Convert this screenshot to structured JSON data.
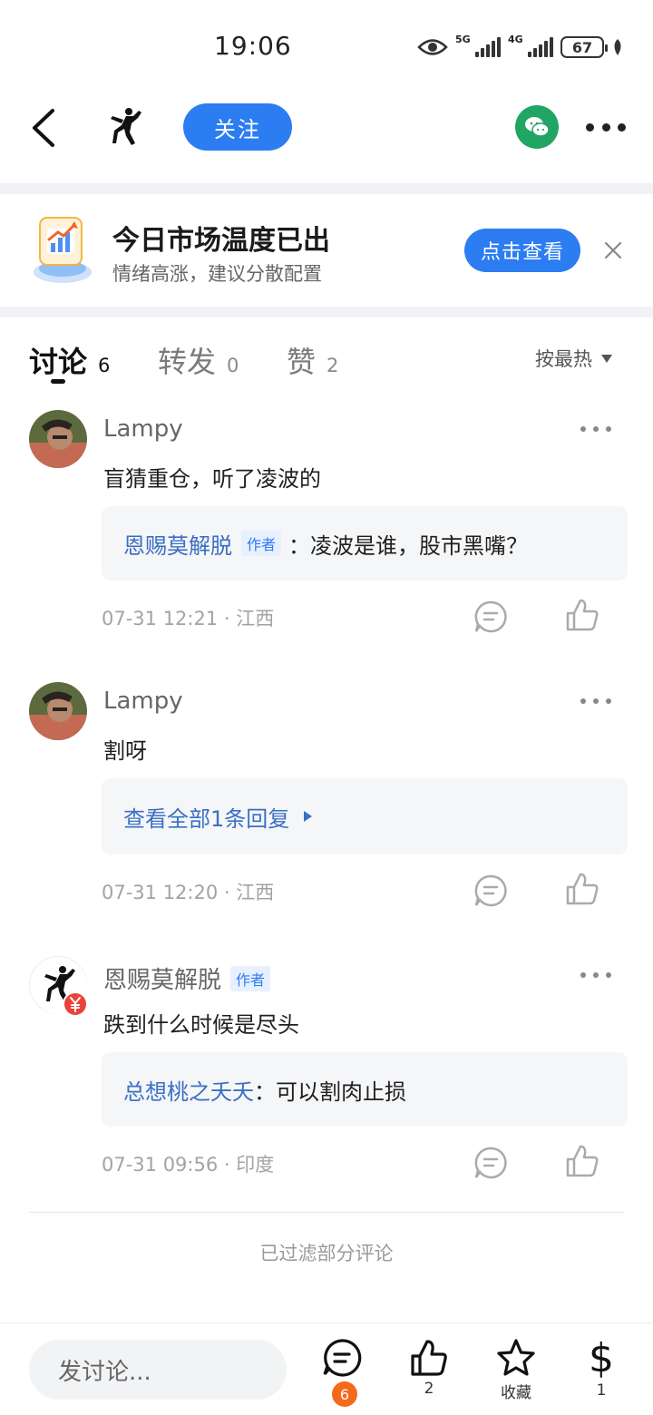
{
  "status_bar": {
    "time": "19:06",
    "net1": "5G",
    "net2": "4G",
    "battery": "67"
  },
  "nav": {
    "follow_label": "关注"
  },
  "banner": {
    "title": "今日市场温度已出",
    "subtitle": "情绪高涨，建议分散配置",
    "button": "点击查看"
  },
  "tabs": [
    {
      "label": "讨论",
      "count": "6"
    },
    {
      "label": "转发",
      "count": "0"
    },
    {
      "label": "赞",
      "count": "2"
    }
  ],
  "sort_label": "按最热",
  "comments": [
    {
      "author": "Lampy",
      "text": "盲猜重仓，听了凌波的",
      "reply_name": "恩赐莫解脱",
      "reply_tag": "作者",
      "reply_text": "：凌波是谁，股市黑嘴？",
      "time": "07-31 12:21 · 江西"
    },
    {
      "author": "Lampy",
      "text": "割呀",
      "view_replies": "查看全部1条回复",
      "time": "07-31 12:20 · 江西"
    },
    {
      "author": "恩赐莫解脱",
      "author_tag": "作者",
      "text": "跌到什么时候是尽头",
      "reply_name": "总想桃之夭夭",
      "reply_text": "：可以割肉止损",
      "time": "07-31 09:56 · 印度"
    }
  ],
  "filtered_note": "已过滤部分评论",
  "bottom_bar": {
    "input_placeholder": "发讨论...",
    "comment_badge": "6",
    "like_count": "2",
    "favorite_label": "收藏",
    "reward_count": "1"
  }
}
